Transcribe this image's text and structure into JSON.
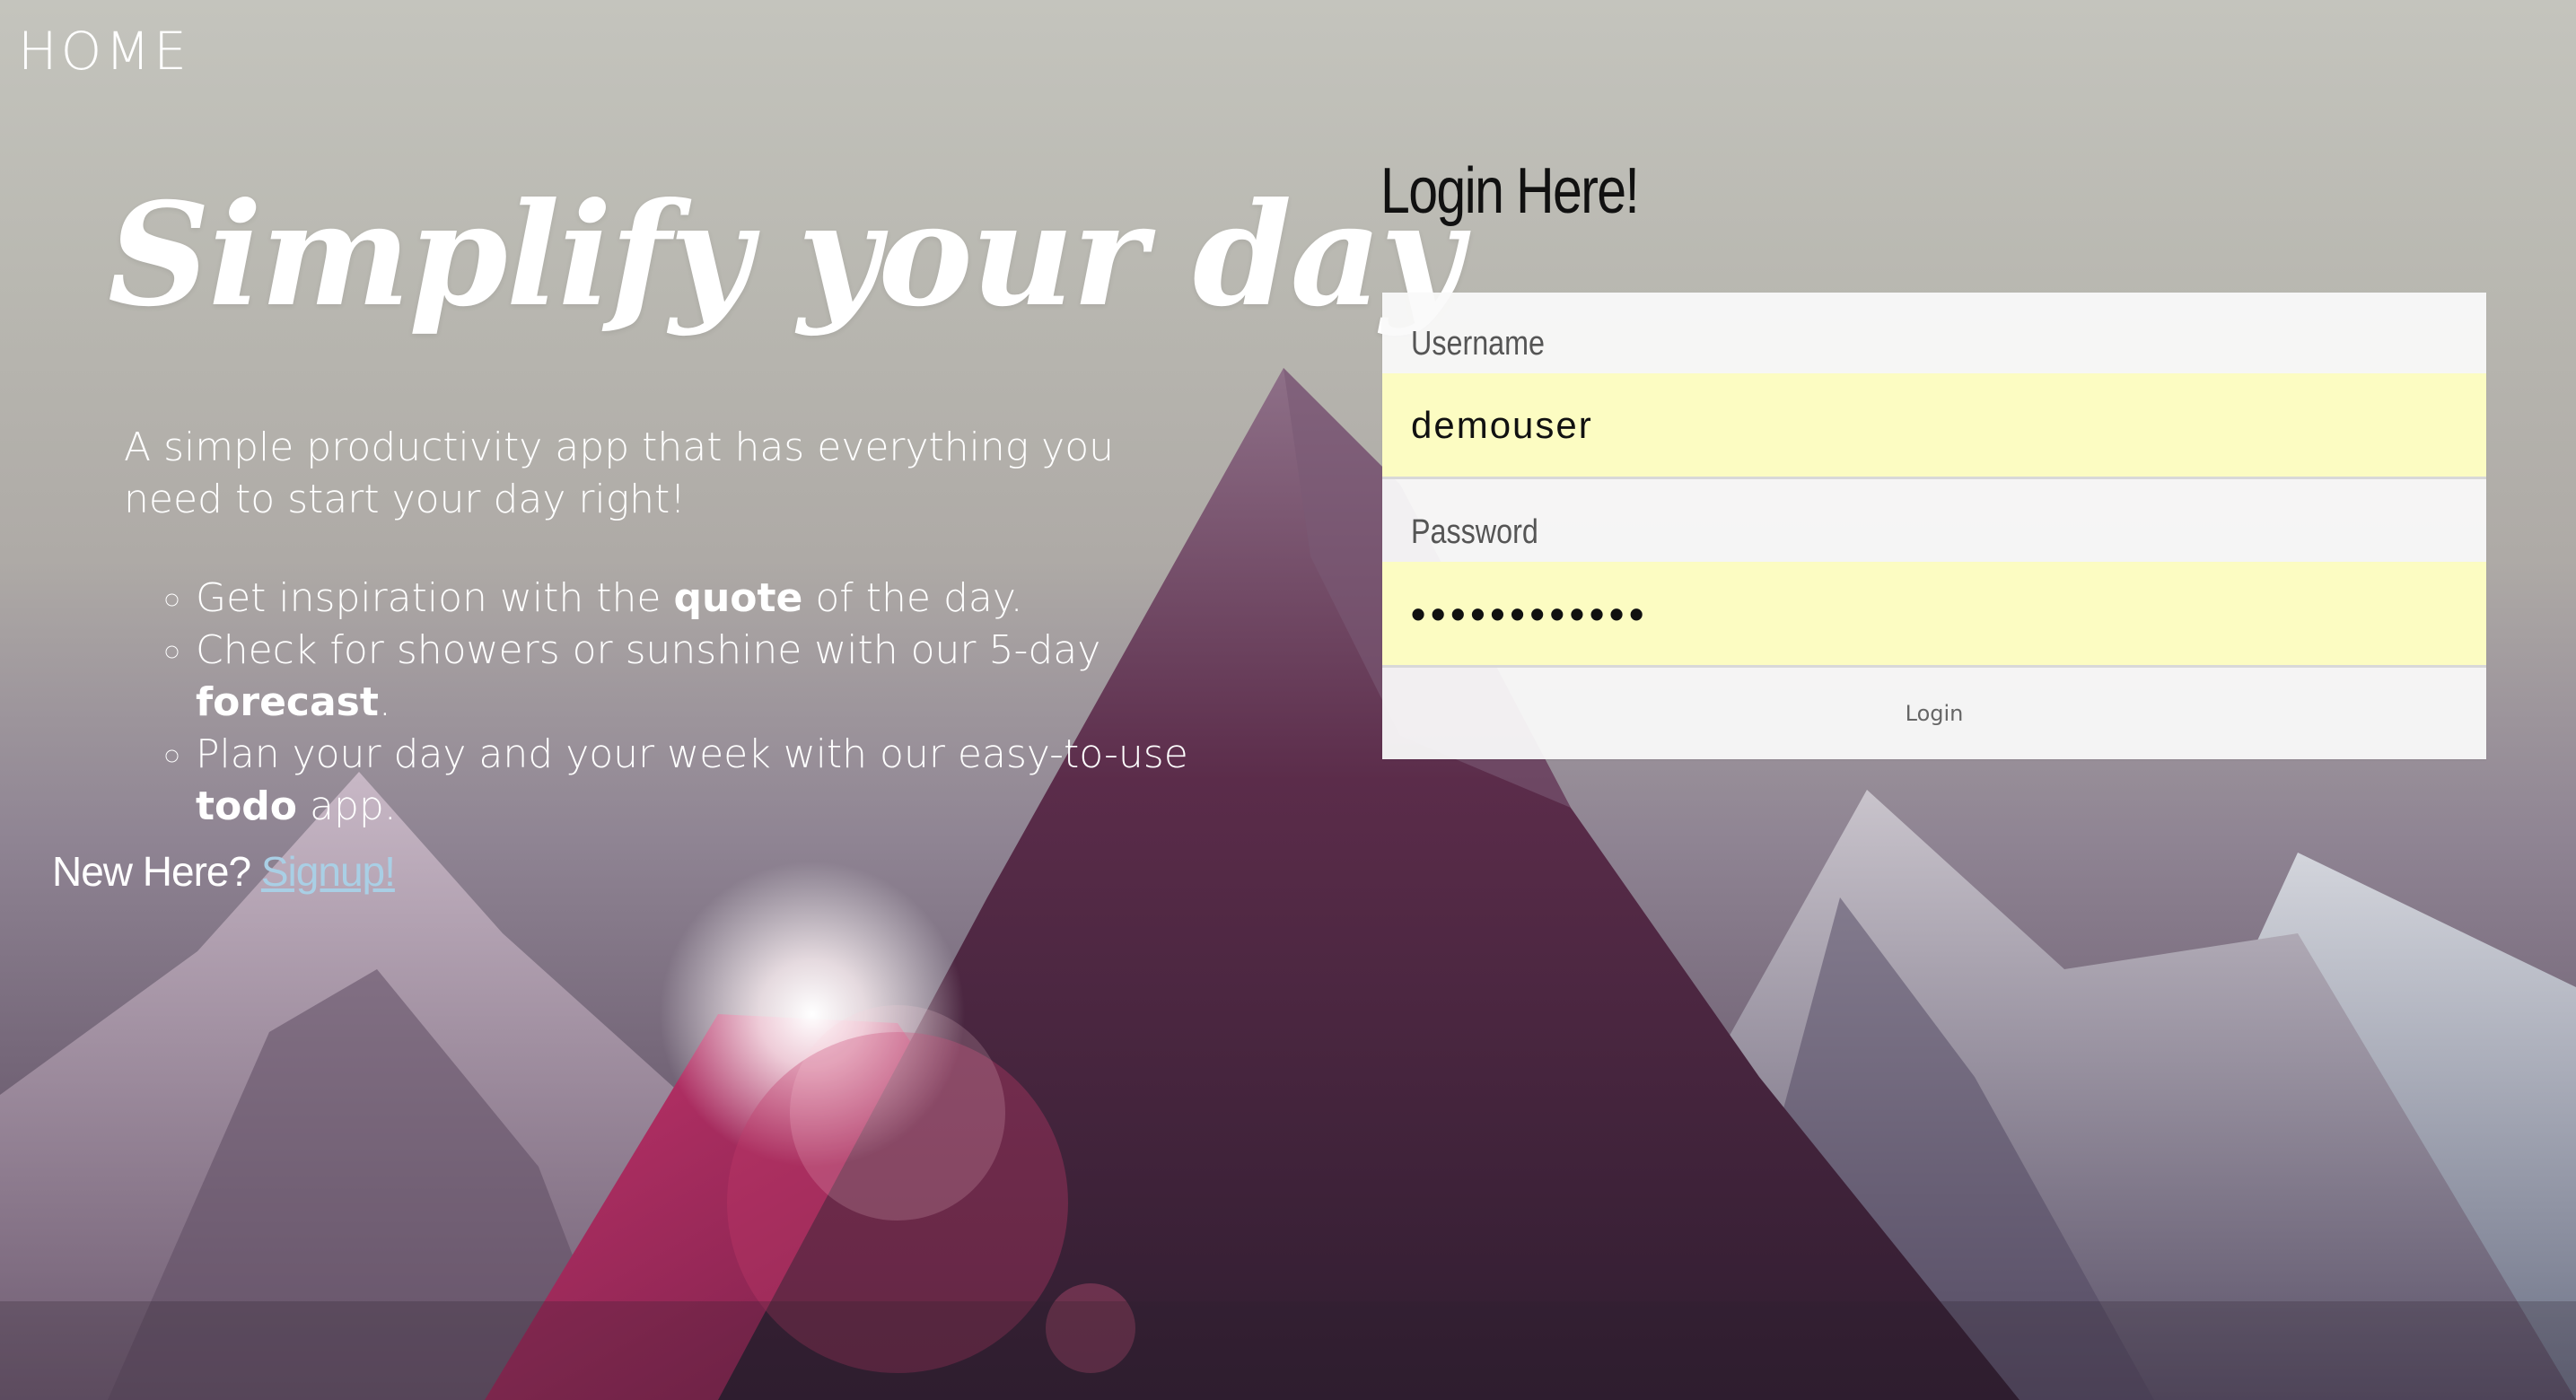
{
  "nav": {
    "home_label": "HOME"
  },
  "hero": {
    "title": "Simplify your day",
    "description": "A simple productivity app that has everything you need to start your day right!",
    "features": [
      {
        "before": "Get inspiration with the ",
        "bold": "quote",
        "after": " of the day."
      },
      {
        "before": "Check for showers or sunshine with our 5-day ",
        "bold": "forecast",
        "after": "."
      },
      {
        "before": "Plan your day and your week with our easy-to-use ",
        "bold": "todo",
        "after": " app."
      }
    ],
    "new_here_text": "New Here? ",
    "signup_label": "Signup!"
  },
  "login": {
    "title": "Login Here!",
    "username_label": "Username",
    "username_value": "demouser",
    "password_label": "Password",
    "password_value": "demopassword",
    "button_label": "Login"
  },
  "colors": {
    "link": "#a9cfe5",
    "autofill_bg": "#fcfcc2",
    "text_light": "#ffffff"
  }
}
